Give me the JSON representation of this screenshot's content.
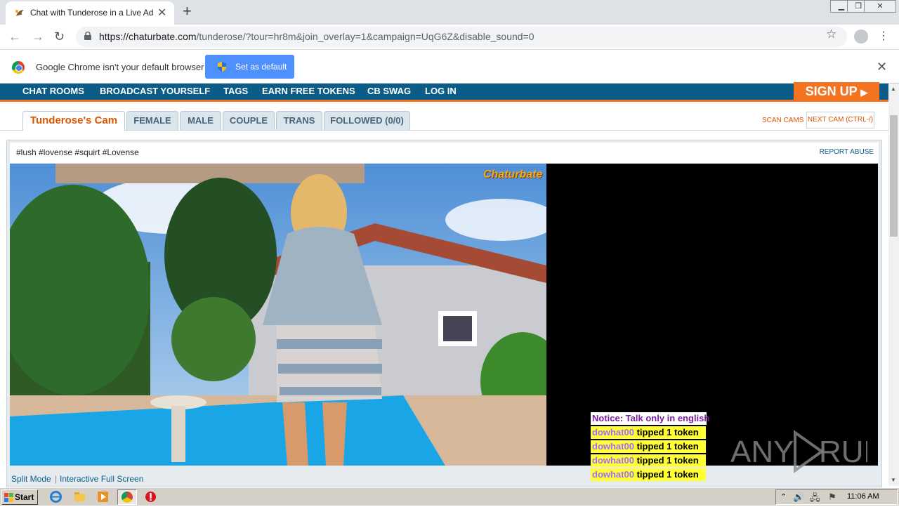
{
  "browser": {
    "tab_title": "Chat with Tunderose in a Live Adult",
    "url_host": "https://chaturbate.com",
    "url_path": "/tunderose/?tour=hr8m&join_overlay=1&campaign=UqG6Z&disable_sound=0"
  },
  "infobar": {
    "message": "Google Chrome isn't your default browser",
    "button_label": "Set as default"
  },
  "site_nav": {
    "items": [
      "CHAT ROOMS",
      "BROADCAST YOURSELF",
      "TAGS",
      "EARN FREE TOKENS",
      "CB SWAG",
      "LOG IN"
    ],
    "signup_label": "SIGN UP"
  },
  "cam_tabs": {
    "items": [
      "Tunderose's Cam",
      "FEMALE",
      "MALE",
      "COUPLE",
      "TRANS",
      "FOLLOWED (0/0)"
    ],
    "scan_cams": "SCAN CAMS",
    "next_cam": "NEXT CAM (CTRL-/)"
  },
  "room": {
    "hashtags": "#lush #lovense #squirt #Lovense",
    "report_abuse": "REPORT ABUSE",
    "split_mode": "Split Mode",
    "separator": "|",
    "fullscreen": "Interactive Full Screen",
    "video_logo": "Chaturbate"
  },
  "chat": {
    "notice": "Notice: Talk only in english",
    "tips": [
      {
        "user": "dowhat00",
        "text": " tipped 1 token"
      },
      {
        "user": "dowhat00",
        "text": " tipped 1 token"
      },
      {
        "user": "dowhat00",
        "text": " tipped 1 token"
      },
      {
        "user": "dowhat00",
        "text": " tipped 1 token"
      }
    ]
  },
  "watermark": "ANY RUN",
  "taskbar": {
    "start_label": "Start",
    "clock": "11:06 AM"
  }
}
